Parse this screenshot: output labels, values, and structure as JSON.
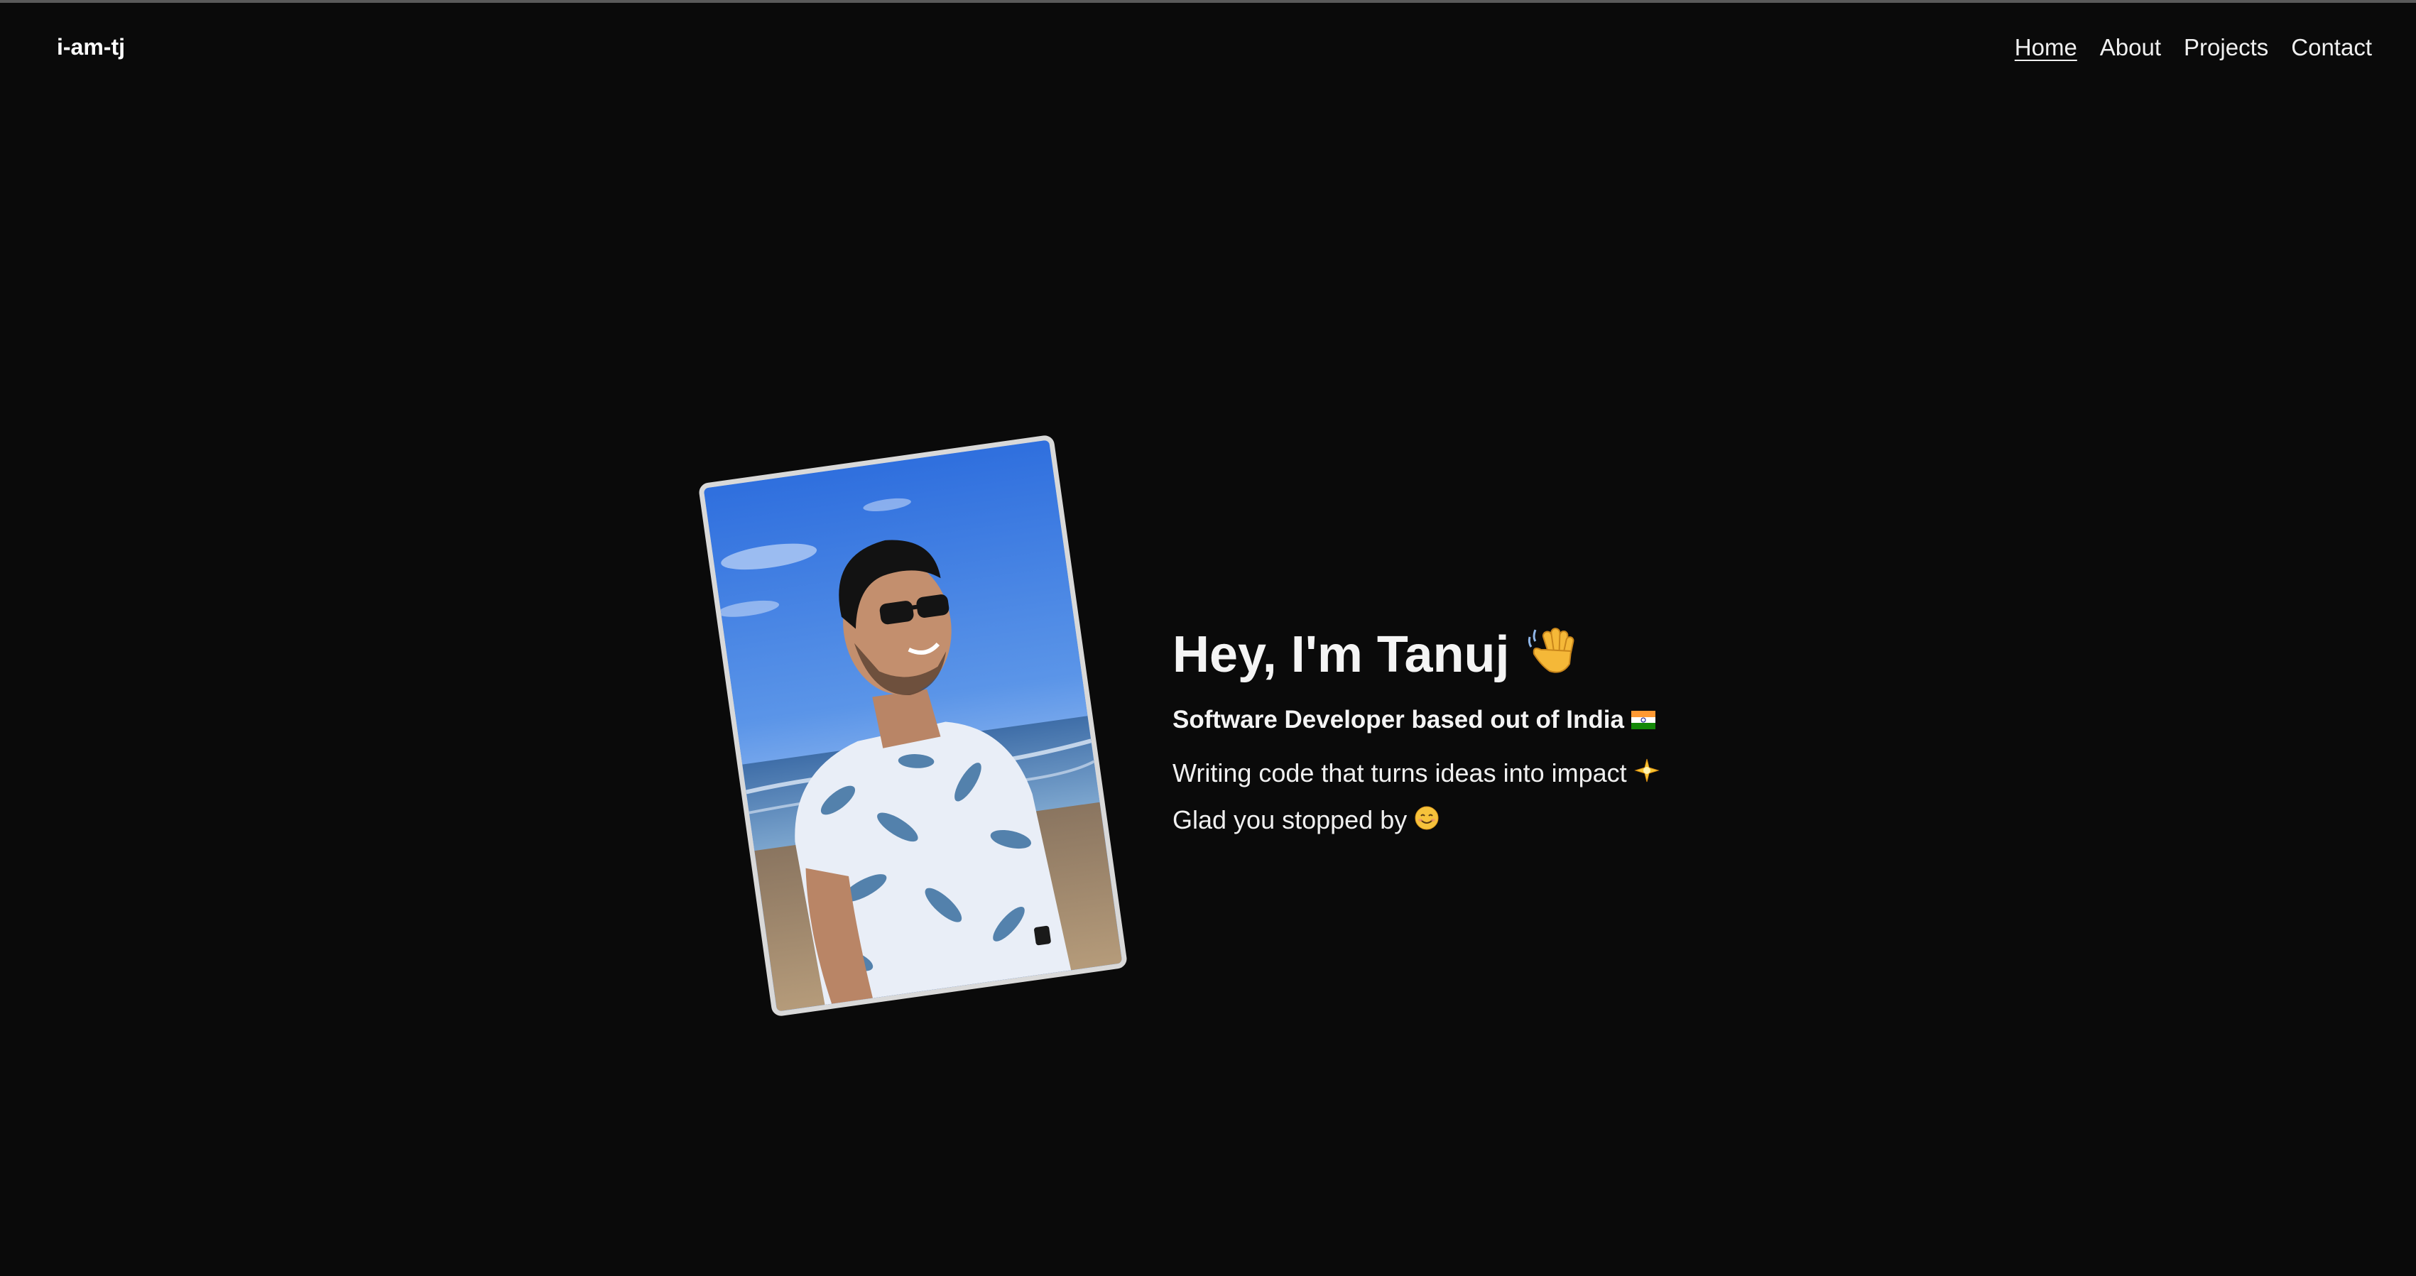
{
  "header": {
    "logo": "i-am-tj",
    "nav": [
      {
        "label": "Home",
        "active": true
      },
      {
        "label": "About",
        "active": false
      },
      {
        "label": "Projects",
        "active": false
      },
      {
        "label": "Contact",
        "active": false
      }
    ]
  },
  "hero": {
    "headline": "Hey, I'm Tanuj",
    "headline_icon": "waving-hand-icon",
    "subheadline": "Software Developer based out of India",
    "subheadline_icon": "india-flag-icon",
    "line1": "Writing code that turns ideas into impact",
    "line1_icon": "sparkle-icon",
    "line2": "Glad you stopped by",
    "line2_icon": "smiling-face-icon",
    "photo": "profile-photo"
  },
  "colors": {
    "background": "#0a0a0a",
    "text": "#f4f4f4",
    "photo_border": "#d9d9d9"
  }
}
